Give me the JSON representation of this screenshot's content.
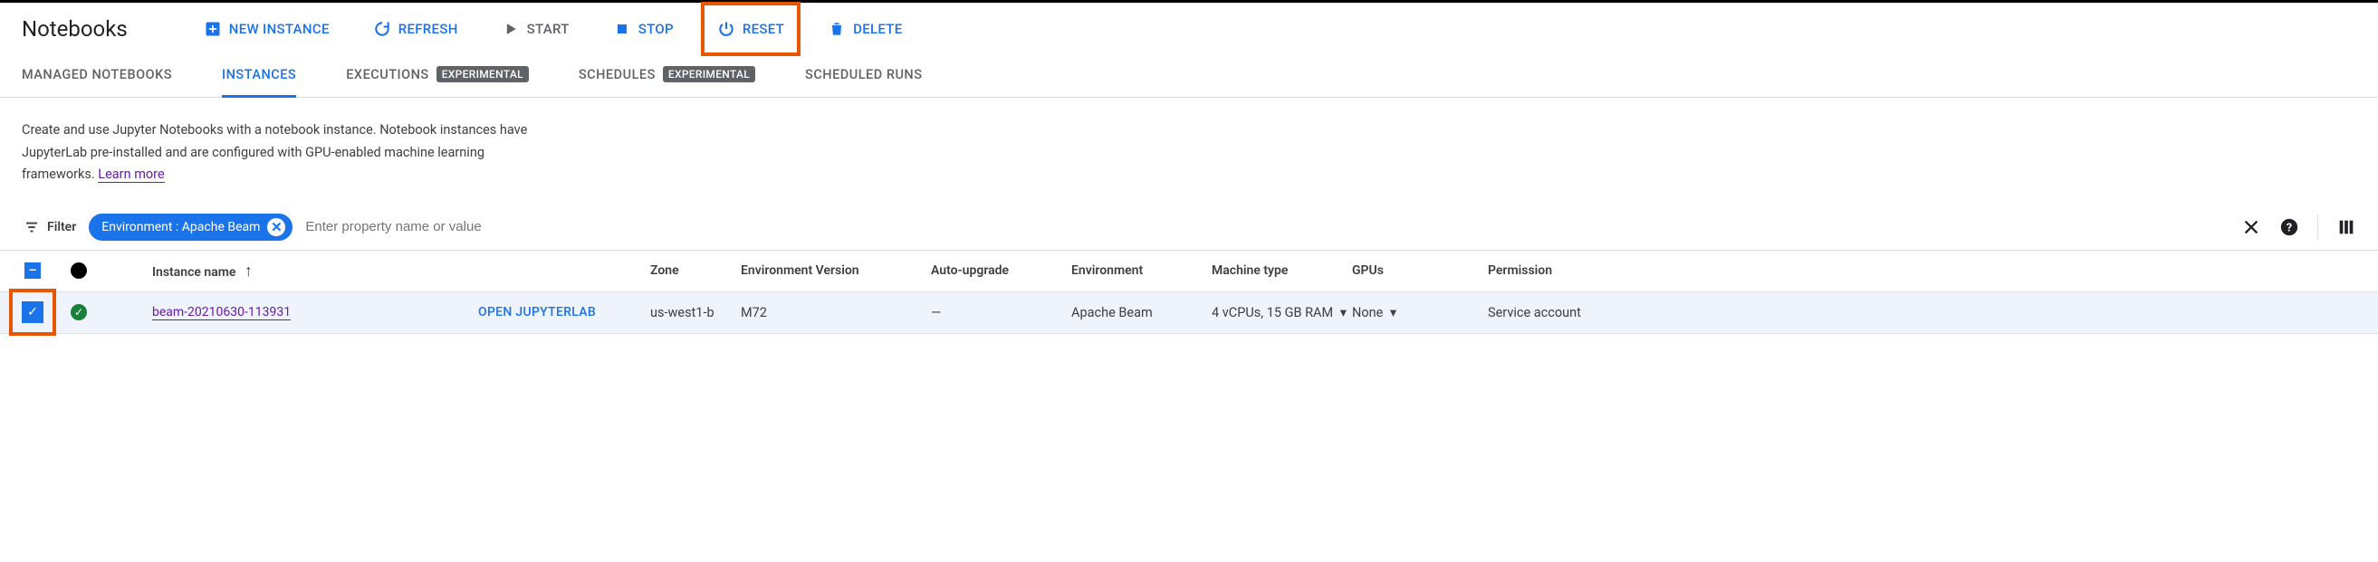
{
  "header": {
    "title": "Notebooks",
    "actions": {
      "new_instance": "NEW INSTANCE",
      "refresh": "REFRESH",
      "start": "START",
      "stop": "STOP",
      "reset": "RESET",
      "delete": "DELETE"
    }
  },
  "tabs": {
    "managed": "MANAGED NOTEBOOKS",
    "instances": "INSTANCES",
    "executions": "EXECUTIONS",
    "schedules": "SCHEDULES",
    "scheduled_runs": "SCHEDULED RUNS",
    "experimental_badge": "EXPERIMENTAL"
  },
  "intro": {
    "text": "Create and use Jupyter Notebooks with a notebook instance. Notebook instances have JupyterLab pre-installed and are configured with GPU-enabled machine learning frameworks. ",
    "learn_more": "Learn more"
  },
  "filter": {
    "label": "Filter",
    "chip_text": "Environment : Apache Beam",
    "placeholder": "Enter property name or value"
  },
  "table": {
    "headers": {
      "instance_name": "Instance name",
      "zone": "Zone",
      "env_version": "Environment Version",
      "auto_upgrade": "Auto-upgrade",
      "environment": "Environment",
      "machine_type": "Machine type",
      "gpus": "GPUs",
      "permission": "Permission"
    },
    "rows": [
      {
        "name": "beam-20210630-113931",
        "open_label": "OPEN JUPYTERLAB",
        "zone": "us-west1-b",
        "env_version": "M72",
        "auto_upgrade": "—",
        "environment": "Apache Beam",
        "machine_type": "4 vCPUs, 15 GB RAM",
        "gpus": "None",
        "permission": "Service account"
      }
    ]
  }
}
